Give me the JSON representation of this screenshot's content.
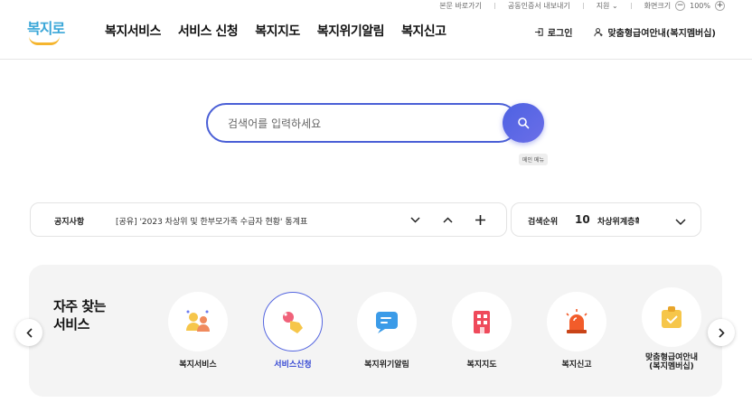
{
  "util": {
    "skip_link": "본문 바로가기",
    "cert": "공동인증서 내보내기",
    "support": "지원",
    "zoom_label": "화면크기",
    "zoom_value": "100%",
    "zoom_minus": "−",
    "zoom_plus": "+"
  },
  "logo": {
    "text": "복지로"
  },
  "gnb": [
    "복지서비스",
    "서비스 신청",
    "복지지도",
    "복지위기알림",
    "복지신고"
  ],
  "header_right": {
    "login": "로그인",
    "membership": "맞춤형급여안내(복지멤버십)"
  },
  "search": {
    "placeholder": "검색어를 입력하세요",
    "tooltip": "메인 메뉴"
  },
  "notice": {
    "label": "공지사항",
    "text": "[공유] '2023 차상위 및 한부모가족 수급자 현황' 통계표"
  },
  "ranking": {
    "label": "검색순위",
    "number": "10",
    "term": "차상위계층확인"
  },
  "services": {
    "title": "자주 찾는 서비스",
    "items": [
      {
        "label": "복지서비스",
        "icon": "people-icon"
      },
      {
        "label": "서비스신청",
        "icon": "hand-click-icon"
      },
      {
        "label": "복지위기알림",
        "icon": "message-icon"
      },
      {
        "label": "복지지도",
        "icon": "building-icon"
      },
      {
        "label": "복지신고",
        "icon": "siren-icon"
      },
      {
        "label": "맞춤형급여안내\n(복지멤버십)",
        "icon": "membership-icon"
      }
    ]
  },
  "colors": {
    "accent": "#4a5fd6",
    "logo_blue": "#3ba7d8",
    "logo_yellow": "#f5b52e"
  }
}
